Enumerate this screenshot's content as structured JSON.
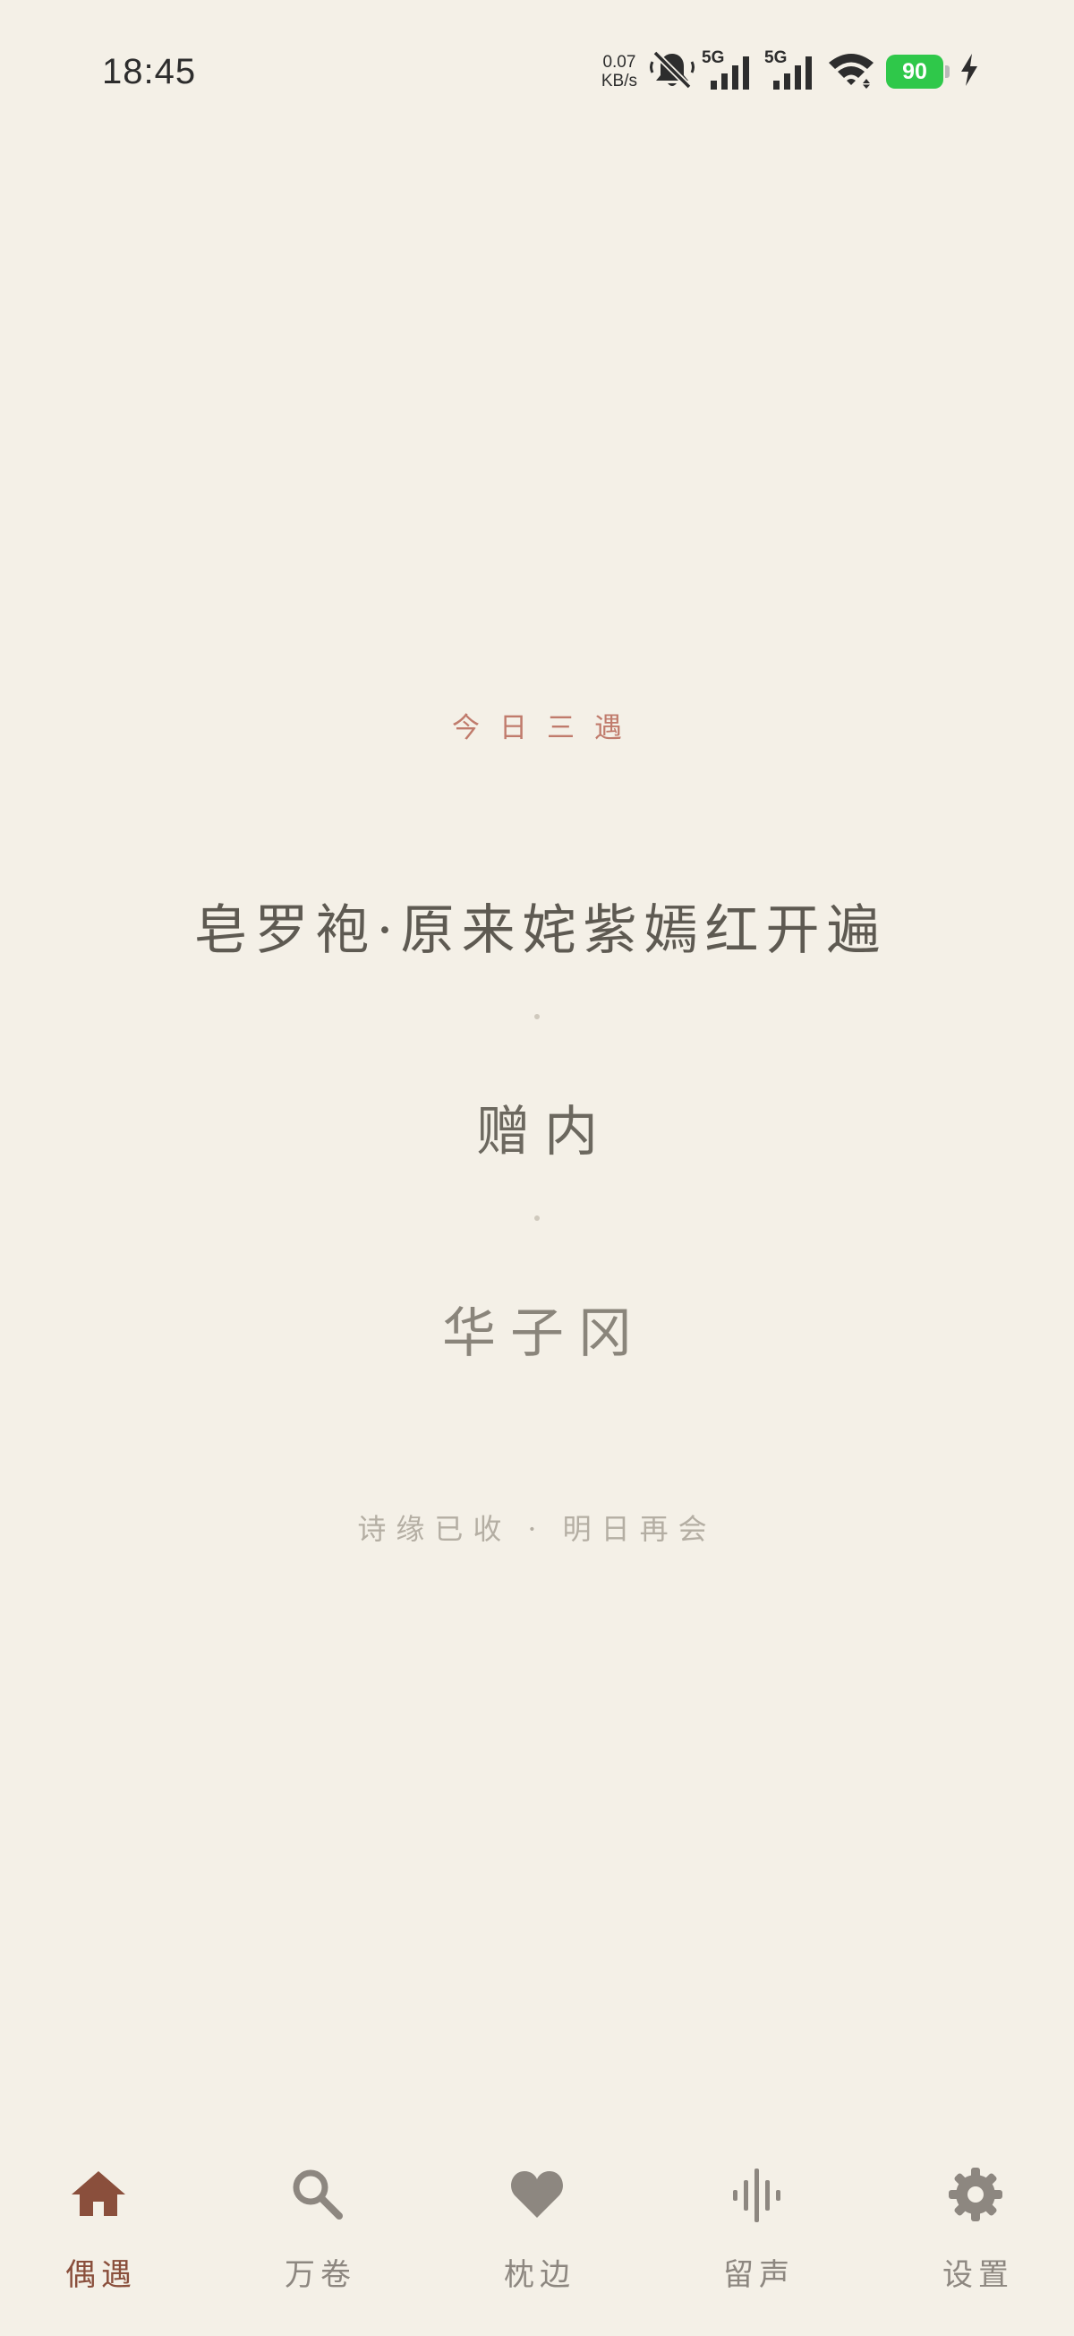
{
  "status_bar": {
    "time": "18:45",
    "net_speed_value": "0.07",
    "net_speed_unit": "KB/s",
    "sim1_label": "5G",
    "sim2_label": "5G",
    "battery_level": "90",
    "battery_color": "#2fc84a",
    "icons": [
      "mute-bell-icon",
      "signal-icon",
      "signal-icon",
      "wifi-icon",
      "battery-icon",
      "charging-bolt-icon"
    ]
  },
  "main": {
    "eyebrow": "今日三遇",
    "poems": [
      "皂罗袍·原来姹紫嫣红开遍",
      "赠内",
      "华子冈"
    ],
    "footer_left": "诗缘已收",
    "footer_sep": "·",
    "footer_right": "明日再会"
  },
  "bottom_nav": {
    "active_index": 0,
    "active_color": "#8a4f3c",
    "inactive_color": "#8d8780",
    "items": [
      {
        "label": "偶遇",
        "icon": "home-icon"
      },
      {
        "label": "万卷",
        "icon": "search-icon"
      },
      {
        "label": "枕边",
        "icon": "heart-icon"
      },
      {
        "label": "留声",
        "icon": "audio-wave-icon"
      },
      {
        "label": "设置",
        "icon": "gear-icon"
      }
    ]
  }
}
